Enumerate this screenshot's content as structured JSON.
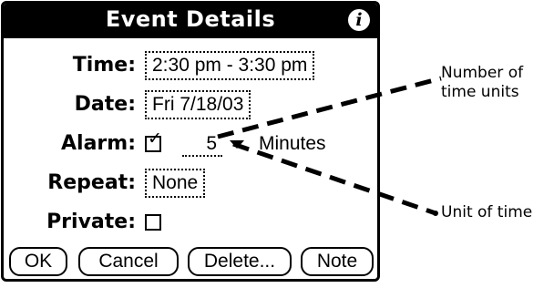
{
  "dialog": {
    "title": "Event Details",
    "info_icon": "info-icon",
    "info_glyph": "i"
  },
  "fields": {
    "time_label": "Time:",
    "time_value": "2:30 pm - 3:30 pm",
    "date_label": "Date:",
    "date_value": "Fri 7/18/03",
    "alarm_label": "Alarm:",
    "alarm_checked": true,
    "alarm_check_glyph": "✓",
    "alarm_number": "5",
    "alarm_unit": "Minutes",
    "repeat_label": "Repeat:",
    "repeat_value": "None",
    "private_label": "Private:",
    "private_checked": false
  },
  "buttons": {
    "ok": "OK",
    "cancel": "Cancel",
    "delete": "Delete...",
    "note": "Note"
  },
  "callouts": {
    "number_line1": "Number of",
    "number_line2": "time units",
    "unit": "Unit of time"
  }
}
